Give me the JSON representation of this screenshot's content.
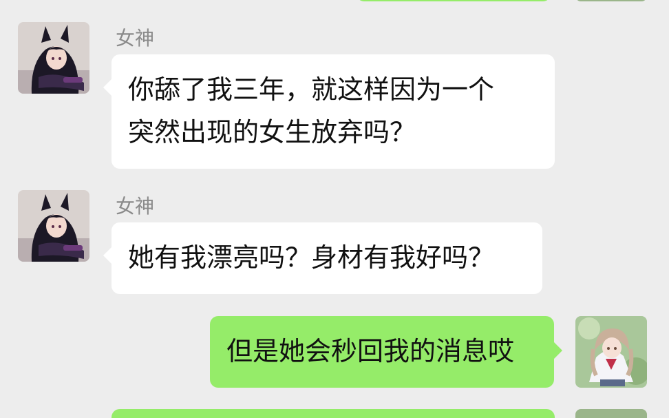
{
  "colors": {
    "background": "#ededed",
    "incoming_bubble": "#ffffff",
    "outgoing_bubble": "#95ec69",
    "name_text": "#8a8a8a"
  },
  "messages": [
    {
      "direction": "incoming",
      "sender": "女神",
      "avatar": "anime-girl-dark-hair-avatar",
      "text": "你舔了我三年，就这样因为一个\n突然出现的女生放弃吗？"
    },
    {
      "direction": "incoming",
      "sender": "女神",
      "avatar": "anime-girl-dark-hair-avatar",
      "text": "她有我漂亮吗？身材有我好吗？"
    },
    {
      "direction": "outgoing",
      "avatar": "anime-girl-light-hair-avatar",
      "text": "但是她会秒回我的消息哎"
    }
  ]
}
